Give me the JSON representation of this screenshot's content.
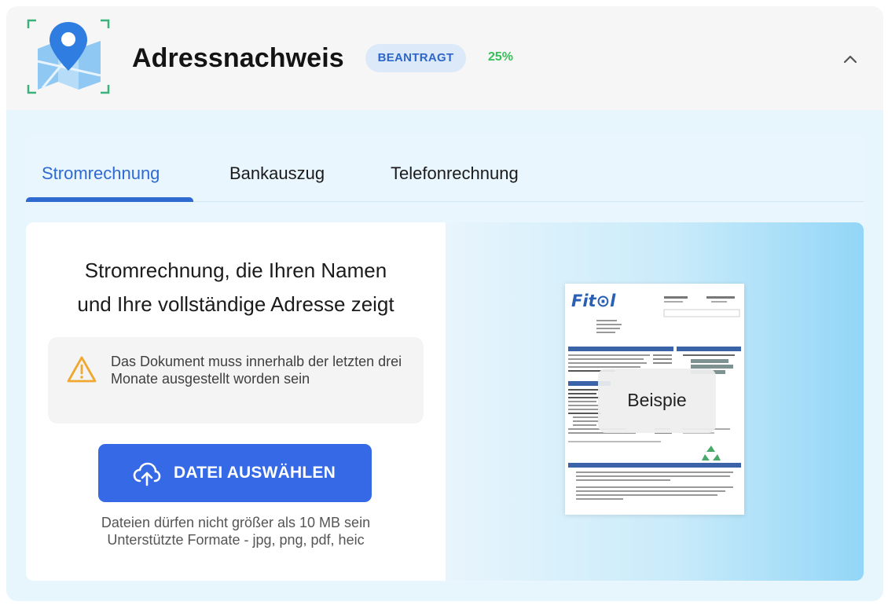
{
  "header": {
    "title": "Adressnachweis",
    "status_badge": "BEANTRAGT",
    "progress": "25%",
    "progress_value": 25,
    "icon": "map-pin-icon",
    "collapse_icon": "chevron-up-icon"
  },
  "tabs": [
    {
      "label": "Stromrechnung",
      "active": true
    },
    {
      "label": "Bankauszug",
      "active": false
    },
    {
      "label": "Telefonrechnung",
      "active": false
    }
  ],
  "main": {
    "heading_line1": "Stromrechnung, die Ihren Namen",
    "heading_line2": "und Ihre vollständige Adresse zeigt",
    "notice": "Das Dokument muss innerhalb der letzten drei Monate ausgestellt worden sein",
    "notice_icon": "warning-icon",
    "upload_label": "DATEI AUSWÄHLEN",
    "upload_icon": "cloud-upload-icon",
    "hint_line1": "Dateien dürfen nicht größer als 10 MB sein",
    "hint_line2": "Unterstützte Formate - jpg, png, pdf, heic"
  },
  "example": {
    "label": "Beispie",
    "doc_logo": "Fit⊙l"
  },
  "colors": {
    "accent": "#3569e6",
    "badge_bg": "#dbe9f8",
    "progress": "#36bf58",
    "warning": "#f0a830"
  }
}
